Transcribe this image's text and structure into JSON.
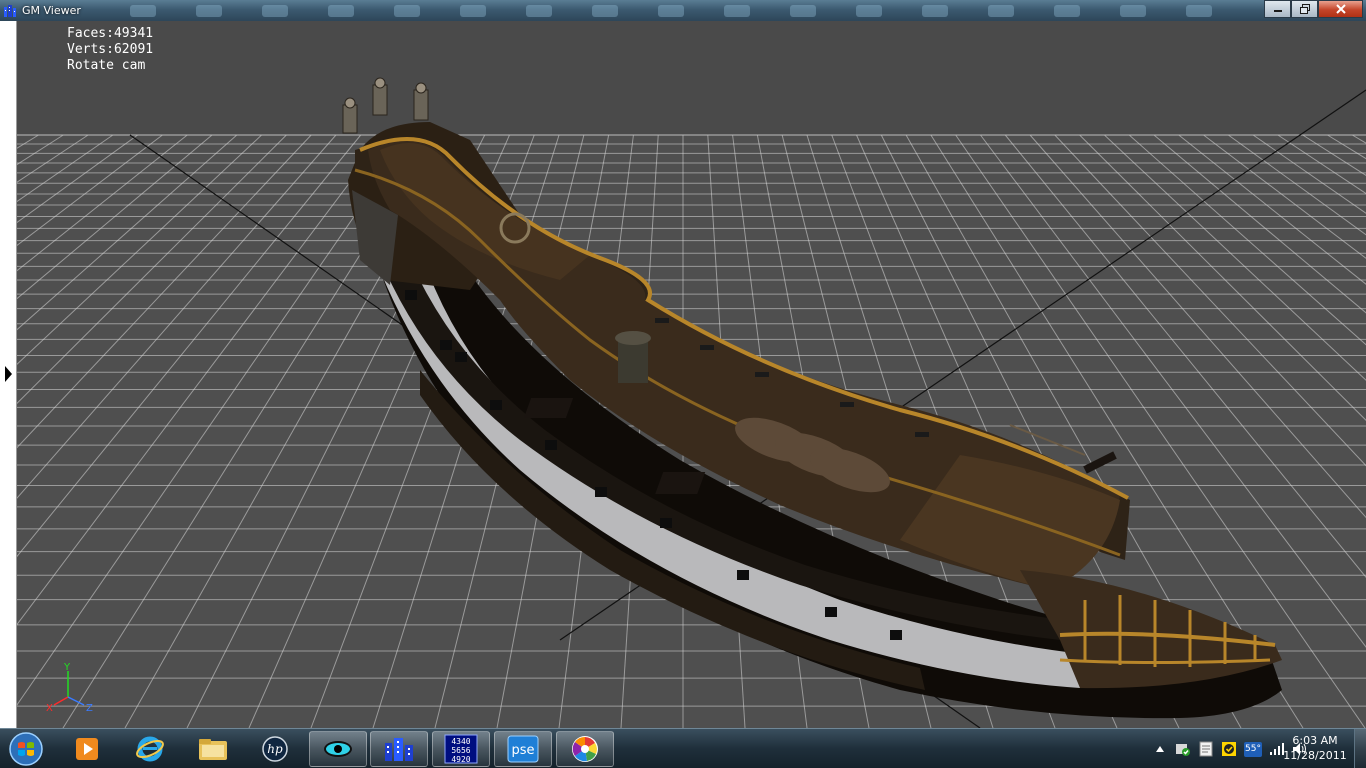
{
  "window": {
    "title": "GM Viewer",
    "icon": "building-grid-icon"
  },
  "viewport": {
    "stats": {
      "faces": "Faces:49341",
      "verts": "Verts:62091",
      "mode": "Rotate cam"
    },
    "background_color": "#4f4f4f",
    "grid_color": "#d9d9d9",
    "axis_labels": {
      "x": "X",
      "y": "Y",
      "z": "Z"
    },
    "axis_colors": {
      "x": "#ff2a2a",
      "y": "#22dd22",
      "z": "#3a7bff"
    }
  },
  "taskbar": {
    "pinned": [
      {
        "name": "media-player-icon"
      },
      {
        "name": "internet-explorer-icon"
      },
      {
        "name": "file-explorer-icon"
      },
      {
        "name": "hp-icon"
      },
      {
        "name": "eye-app-icon"
      },
      {
        "name": "gm-viewer-icon",
        "active": true
      },
      {
        "name": "number-grid-icon",
        "digits": [
          "4340",
          "5656",
          "4920"
        ]
      },
      {
        "name": "pse-icon",
        "label": "pse"
      },
      {
        "name": "picasa-icon"
      }
    ],
    "tray": {
      "temperature": "55°",
      "time": "6:03 AM",
      "date": "11/28/2011"
    }
  }
}
